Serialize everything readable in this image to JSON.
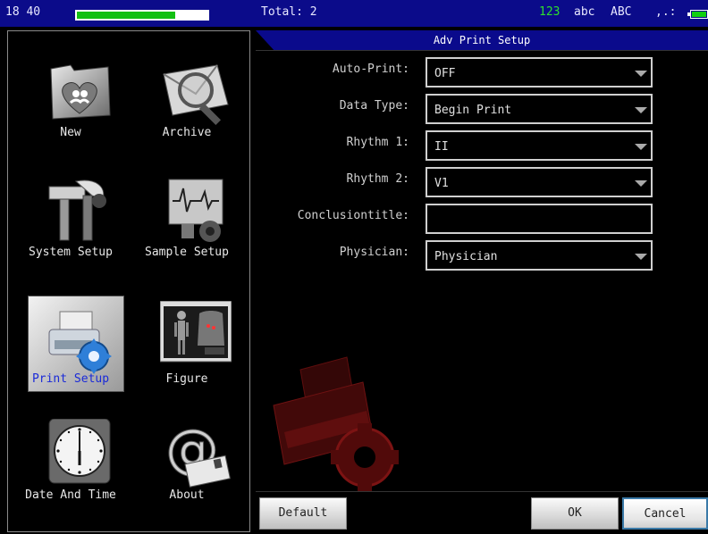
{
  "status_bar": {
    "clock": "18 40",
    "battery_level": 0.75,
    "total_label": "Total: 2",
    "ime_numeric": "123",
    "ime_lower": "abc",
    "ime_upper": "ABC",
    "ime_punct": ",.:"
  },
  "menu": {
    "items": [
      {
        "label": "New",
        "icon": "folder-heart-icon"
      },
      {
        "label": "Archive",
        "icon": "magnifier-envelope-icon"
      },
      {
        "label": "System Setup",
        "icon": "tools-icon"
      },
      {
        "label": "Sample Setup",
        "icon": "ecg-monitor-icon"
      },
      {
        "label": "Print Setup",
        "icon": "printer-gear-icon",
        "selected": true
      },
      {
        "label": "Figure",
        "icon": "body-figure-icon"
      },
      {
        "label": "Date And Time",
        "icon": "clock-icon"
      },
      {
        "label": "About",
        "icon": "at-sign-icon"
      }
    ]
  },
  "dialog": {
    "title": "Adv Print Setup",
    "fields": [
      {
        "label": "Auto-Print:",
        "value": "OFF",
        "type": "dropdown"
      },
      {
        "label": "Data Type:",
        "value": "Begin Print",
        "type": "dropdown"
      },
      {
        "label": "Rhythm 1:",
        "value": "II",
        "type": "dropdown"
      },
      {
        "label": "Rhythm 2:",
        "value": "V1",
        "type": "dropdown"
      },
      {
        "label": "Conclusiontitle:",
        "value": "",
        "type": "text"
      },
      {
        "label": "Physician:",
        "value": "Physician",
        "type": "dropdown"
      }
    ],
    "buttons": {
      "default": "Default",
      "ok": "OK",
      "cancel": "Cancel"
    }
  },
  "colors": {
    "status_bar_bg": "#0b0b8a",
    "title_bar_bg": "#0a0a8c",
    "selected_label": "#1a2ad8",
    "watermark": "#7a0c0c"
  }
}
